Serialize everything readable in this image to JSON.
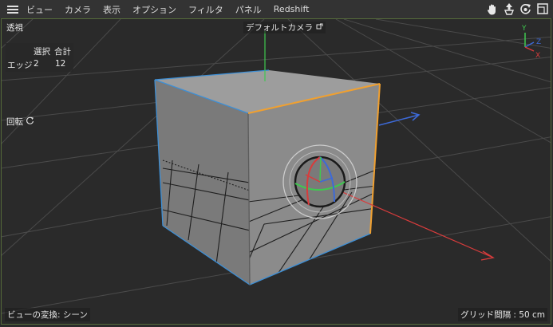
{
  "menu": {
    "items": [
      {
        "id": "view",
        "label": "ビュー"
      },
      {
        "id": "camera",
        "label": "カメラ"
      },
      {
        "id": "display",
        "label": "表示"
      },
      {
        "id": "options",
        "label": "オプション"
      },
      {
        "id": "filter",
        "label": "フィルタ"
      },
      {
        "id": "panel",
        "label": "パネル"
      },
      {
        "id": "redshift",
        "label": "Redshift"
      }
    ],
    "nav_icons": [
      "hand-pan-icon",
      "move-dolly-icon",
      "rotate-orbit-icon",
      "maximize-view-icon"
    ]
  },
  "viewport": {
    "view_name": "透視",
    "camera_label": "デフォルトカメラ",
    "stats": {
      "col_selected": "選択",
      "col_total": "合計",
      "row_label": "エッジ",
      "selected": "2",
      "total": "12"
    },
    "rotate_label": "回転",
    "transform_label": "ビューの変換: シーン",
    "grid_label": "グリッド間隔 : 50 cm"
  },
  "axis": {
    "y": "Y",
    "z": "Z",
    "x": "X"
  },
  "colors": {
    "menubar": "#333333",
    "viewport_bg": "#2a2a2a",
    "viewport_border": "#556b3a",
    "cube_front": "#8b8b8b",
    "cube_top": "#9d9d9d",
    "edge_selected": "#f0a030",
    "edge_blue": "#3d8fd6",
    "axis_x": "#d83c3c",
    "axis_y": "#3fc94f",
    "axis_z": "#3d6ad8"
  }
}
